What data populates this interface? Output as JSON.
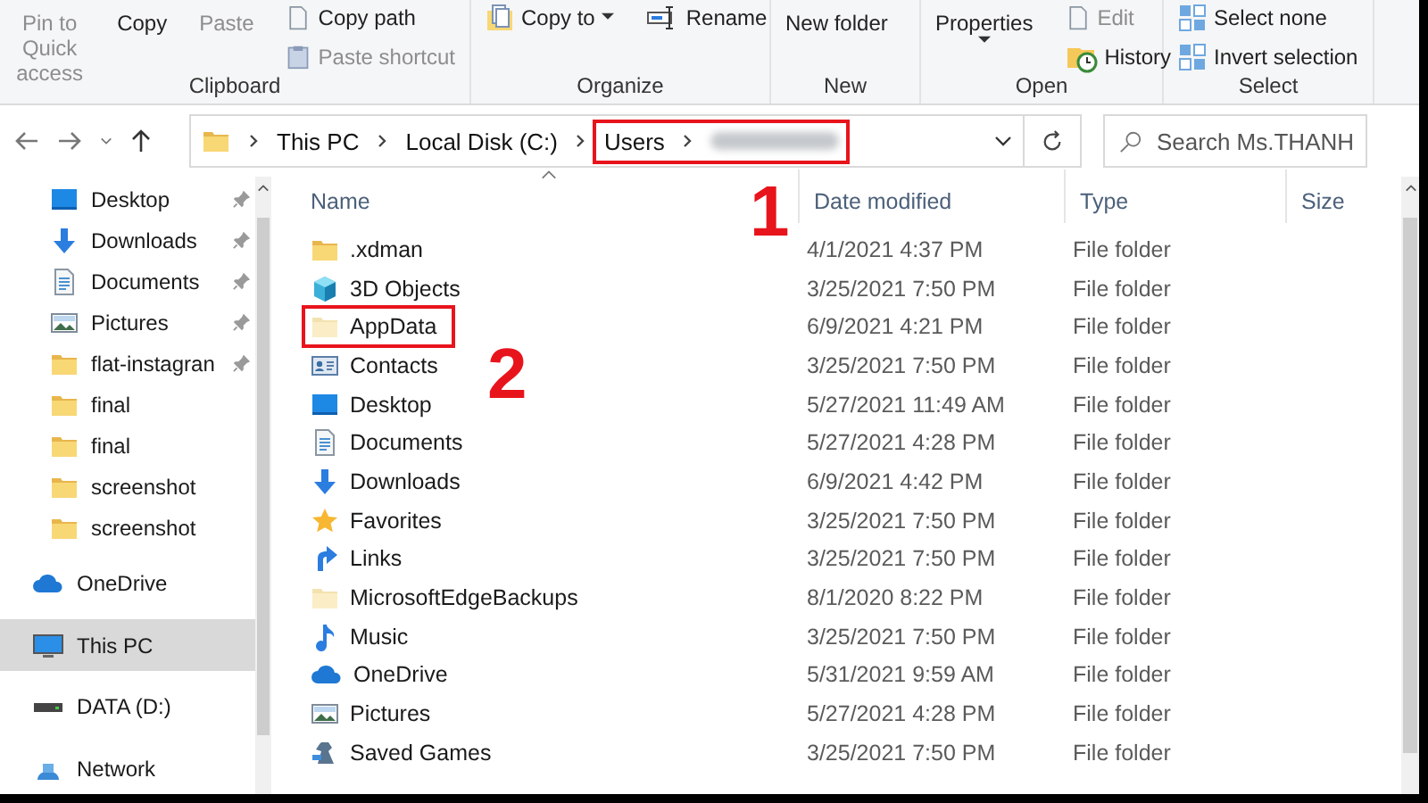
{
  "ribbon": {
    "groups": [
      {
        "label": "Clipboard",
        "columns": [
          {
            "kind": "large",
            "label": "Pin to Quick access",
            "disabled": true
          },
          {
            "kind": "large",
            "label": "Copy",
            "disabled": false
          },
          {
            "kind": "large",
            "label": "Paste",
            "disabled": true
          },
          {
            "kind": "stack",
            "items": [
              {
                "label": "Copy path",
                "kind": "page",
                "disabled": false
              },
              {
                "label": "Paste shortcut",
                "kind": "clipboard",
                "disabled": true
              }
            ]
          }
        ]
      },
      {
        "label": "Organize",
        "columns": [
          {
            "kind": "stack",
            "items": [
              {
                "label": "Copy to",
                "kind": "copy-to",
                "disabled": false,
                "dropdown": true
              }
            ]
          },
          {
            "kind": "stack",
            "items": [
              {
                "label": "Rename",
                "kind": "rename",
                "disabled": false
              }
            ]
          }
        ]
      },
      {
        "label": "New",
        "columns": [
          {
            "kind": "large",
            "label": "New folder",
            "disabled": false
          }
        ]
      },
      {
        "label": "Open",
        "columns": [
          {
            "kind": "large",
            "label": "Properties",
            "disabled": false,
            "dropdown": true
          },
          {
            "kind": "stack",
            "items": [
              {
                "label": "Edit",
                "kind": "page",
                "disabled": true
              },
              {
                "label": "History",
                "kind": "history",
                "disabled": false
              }
            ]
          }
        ]
      },
      {
        "label": "Select",
        "columns": [
          {
            "kind": "stack",
            "items": [
              {
                "label": "Select none",
                "kind": "grid",
                "disabled": false
              },
              {
                "label": "Invert selection",
                "kind": "grid",
                "disabled": false
              }
            ]
          }
        ]
      }
    ]
  },
  "address_bar": {
    "crumbs": [
      {
        "kind": "text",
        "label": "This PC",
        "highlighted": false
      },
      {
        "kind": "text",
        "label": "Local Disk (C:)",
        "highlighted": false
      },
      {
        "kind": "text",
        "label": "Users",
        "highlighted": true
      },
      {
        "kind": "redacted",
        "highlighted": true
      }
    ],
    "search": {
      "placeholder": "Search Ms.THANH"
    }
  },
  "sidebar": {
    "quick_access_items": [
      {
        "label": "Desktop",
        "kind": "desktop",
        "pinned": true,
        "selected": false
      },
      {
        "label": "Downloads",
        "kind": "downloads",
        "pinned": true,
        "selected": false
      },
      {
        "label": "Documents",
        "kind": "documents",
        "pinned": true,
        "selected": false
      },
      {
        "label": "Pictures",
        "kind": "pictures",
        "pinned": true,
        "selected": false
      },
      {
        "label": "flat-instagran",
        "kind": "folder",
        "pinned": true,
        "selected": false
      },
      {
        "label": "final",
        "kind": "folder",
        "pinned": false,
        "selected": false
      },
      {
        "label": "final",
        "kind": "folder",
        "pinned": false,
        "selected": false
      },
      {
        "label": "screenshot",
        "kind": "folder",
        "pinned": false,
        "selected": false
      },
      {
        "label": "screenshot",
        "kind": "folder",
        "pinned": false,
        "selected": false
      }
    ],
    "items": [
      {
        "label": "OneDrive",
        "kind": "onedrive",
        "selected": false
      },
      {
        "label": "This PC",
        "kind": "pc",
        "selected": true
      },
      {
        "label": "DATA (D:)",
        "kind": "drive",
        "selected": false
      },
      {
        "label": "Network",
        "kind": "network",
        "selected": false
      }
    ]
  },
  "file_list": {
    "columns": [
      {
        "label": "Name",
        "sorted": true
      },
      {
        "label": "Date modified",
        "sorted": false
      },
      {
        "label": "Type",
        "sorted": false
      },
      {
        "label": "Size",
        "sorted": false
      }
    ],
    "rows": [
      {
        "name": ".xdman",
        "kind": "folder",
        "date": "4/1/2021 4:37 PM",
        "type": "File folder",
        "highlighted": false
      },
      {
        "name": "3D Objects",
        "kind": "cube",
        "date": "3/25/2021 7:50 PM",
        "type": "File folder",
        "highlighted": false
      },
      {
        "name": "AppData",
        "kind": "folder-hidden",
        "date": "6/9/2021 4:21 PM",
        "type": "File folder",
        "highlighted": true
      },
      {
        "name": "Contacts",
        "kind": "contacts",
        "date": "3/25/2021 7:50 PM",
        "type": "File folder",
        "highlighted": false
      },
      {
        "name": "Desktop",
        "kind": "desktop",
        "date": "5/27/2021 11:49 AM",
        "type": "File folder",
        "highlighted": false
      },
      {
        "name": "Documents",
        "kind": "documents",
        "date": "5/27/2021 4:28 PM",
        "type": "File folder",
        "highlighted": false
      },
      {
        "name": "Downloads",
        "kind": "downloads",
        "date": "6/9/2021 4:42 PM",
        "type": "File folder",
        "highlighted": false
      },
      {
        "name": "Favorites",
        "kind": "favorites",
        "date": "3/25/2021 7:50 PM",
        "type": "File folder",
        "highlighted": false
      },
      {
        "name": "Links",
        "kind": "links",
        "date": "3/25/2021 7:50 PM",
        "type": "File folder",
        "highlighted": false
      },
      {
        "name": "MicrosoftEdgeBackups",
        "kind": "folder-hidden",
        "date": "8/1/2020 8:22 PM",
        "type": "File folder",
        "highlighted": false
      },
      {
        "name": "Music",
        "kind": "music",
        "date": "3/25/2021 7:50 PM",
        "type": "File folder",
        "highlighted": false
      },
      {
        "name": "OneDrive",
        "kind": "onedrive",
        "date": "5/31/2021 9:59 AM",
        "type": "File folder",
        "highlighted": false
      },
      {
        "name": "Pictures",
        "kind": "pictures",
        "date": "5/27/2021 4:28 PM",
        "type": "File folder",
        "highlighted": false
      },
      {
        "name": "Saved Games",
        "kind": "saved-games",
        "date": "3/25/2021 7:50 PM",
        "type": "File folder",
        "highlighted": false
      }
    ]
  },
  "annotations": [
    {
      "label": "1"
    },
    {
      "label": "2"
    }
  ]
}
